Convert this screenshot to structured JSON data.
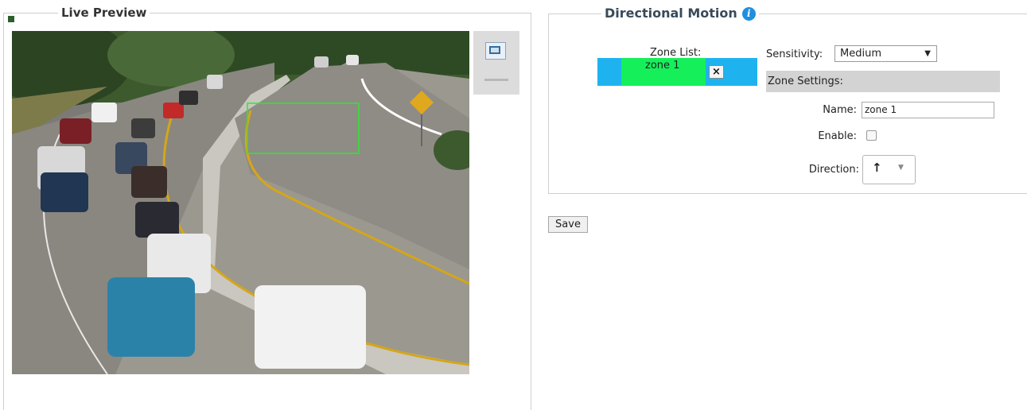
{
  "live_preview": {
    "legend": "Live Preview"
  },
  "directional_motion": {
    "legend": "Directional Motion",
    "info_icon": "info-icon",
    "zone_list_label": "Zone List:",
    "zones": [
      {
        "name": "zone 1",
        "delete_glyph": "×"
      }
    ],
    "sensitivity_label": "Sensitivity:",
    "sensitivity_value": "Medium",
    "zone_settings_label": "Zone Settings:",
    "name_label": "Name:",
    "name_value": "zone 1",
    "enable_label": "Enable:",
    "enable_checked": false,
    "direction_label": "Direction:",
    "direction_value": "↑"
  },
  "save_label": "Save",
  "colors": {
    "zone_list_bg": "#1eb3ef",
    "zone_selected": "#15f05a",
    "zone_outline": "#2ee82e",
    "info_icon": "#1f8fe0"
  }
}
